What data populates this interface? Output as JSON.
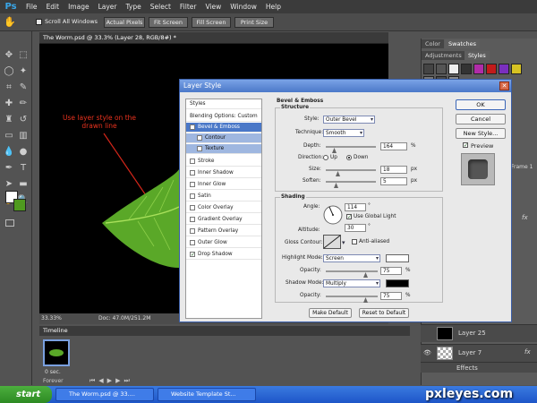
{
  "menubar": {
    "logo": "Ps",
    "items": [
      "File",
      "Edit",
      "Image",
      "Layer",
      "Type",
      "Select",
      "Filter",
      "View",
      "Window",
      "Help"
    ]
  },
  "options": {
    "scroll_all": "Scroll All Windows",
    "actual_pixels": "Actual Pixels",
    "fit_screen": "Fit Screen",
    "fill_screen": "Fill Screen",
    "print_size": "Print Size"
  },
  "document": {
    "tab_title": "The Worm.psd @ 33.3% (Layer 28, RGB/8#) *",
    "annotation": "Use layer style on the drawn line",
    "zoom": "33.33%",
    "doc_info": "Doc: 47.0M/251.2M"
  },
  "timeline": {
    "title": "Timeline",
    "frame_delay": "0 sec.",
    "loop": "Forever"
  },
  "panels": {
    "color_tab": "Color",
    "swatches_tab": "Swatches",
    "adjustments_tab": "Adjustments",
    "styles_tab": "Styles",
    "frame_label": "Frame 1",
    "fx": "fx",
    "layers": [
      {
        "name": "Layer 25"
      },
      {
        "name": "Layer 7"
      },
      {
        "name": "Effects"
      }
    ]
  },
  "dialog": {
    "title": "Layer Style",
    "styles_header": "Styles",
    "blending_options": "Blending Options: Custom",
    "style_items": [
      {
        "label": "Bevel & Emboss",
        "checked": true
      },
      {
        "label": "Contour",
        "checked": false
      },
      {
        "label": "Texture",
        "checked": false
      },
      {
        "label": "Stroke",
        "checked": false
      },
      {
        "label": "Inner Shadow",
        "checked": false
      },
      {
        "label": "Inner Glow",
        "checked": false
      },
      {
        "label": "Satin",
        "checked": false
      },
      {
        "label": "Color Overlay",
        "checked": false
      },
      {
        "label": "Gradient Overlay",
        "checked": false
      },
      {
        "label": "Pattern Overlay",
        "checked": false
      },
      {
        "label": "Outer Glow",
        "checked": false
      },
      {
        "label": "Drop Shadow",
        "checked": true
      }
    ],
    "section_title": "Bevel & Emboss",
    "structure": {
      "title": "Structure",
      "style_label": "Style:",
      "style_value": "Outer Bevel",
      "technique_label": "Technique:",
      "technique_value": "Smooth",
      "depth_label": "Depth:",
      "depth_value": "164",
      "depth_unit": "%",
      "direction_label": "Direction:",
      "direction_up": "Up",
      "direction_down": "Down",
      "direction_selected": "Down",
      "size_label": "Size:",
      "size_value": "18",
      "size_unit": "px",
      "soften_label": "Soften:",
      "soften_value": "5",
      "soften_unit": "px"
    },
    "shading": {
      "title": "Shading",
      "angle_label": "Angle:",
      "angle_value": "114",
      "angle_unit": "°",
      "global_light_label": "Use Global Light",
      "global_light": true,
      "altitude_label": "Altitude:",
      "altitude_value": "30",
      "altitude_unit": "°",
      "gloss_label": "Gloss Contour:",
      "anti_aliased_label": "Anti-aliased",
      "highlight_mode_label": "Highlight Mode:",
      "highlight_mode_value": "Screen",
      "highlight_color": "#ffffff",
      "highlight_opacity_label": "Opacity:",
      "highlight_opacity_value": "75",
      "shadow_mode_label": "Shadow Mode:",
      "shadow_mode_value": "Multiply",
      "shadow_color": "#000000",
      "shadow_opacity_label": "Opacity:",
      "shadow_opacity_value": "75",
      "pct": "%"
    },
    "make_default": "Make Default",
    "reset_default": "Reset to Default",
    "ok": "OK",
    "cancel": "Cancel",
    "new_style": "New Style...",
    "preview": "Preview"
  },
  "taskbar": {
    "start": "start",
    "tasks": [
      "The Worm.psd @ 33....",
      "Website Template St..."
    ],
    "watermark": "pxleyes.com"
  },
  "colors": {
    "accent": "#4a78c8",
    "annotation": "#e8321e",
    "leaf": "#6fbf2a"
  }
}
